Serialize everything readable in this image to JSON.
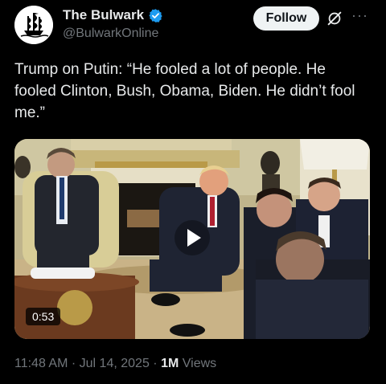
{
  "account": {
    "name": "The Bulwark",
    "handle": "@BulwarkOnline",
    "avatar_icon": "pirate-ship-logo",
    "verified_color": "#1d9bf0"
  },
  "header": {
    "follow_label": "Follow",
    "grok_icon": "grok-icon",
    "more_label": "···"
  },
  "tweet": {
    "text": "Trump on Putin: “He fooled a lot of people. He fooled Clinton, Bush, Obama, Biden. He didn’t fool me.”"
  },
  "video": {
    "duration": "0:53",
    "play_icon": "play-icon"
  },
  "meta": {
    "time": "11:48 AM",
    "separator": "·",
    "date": "Jul 14, 2025",
    "views_count": "1M",
    "views_label": "Views"
  }
}
